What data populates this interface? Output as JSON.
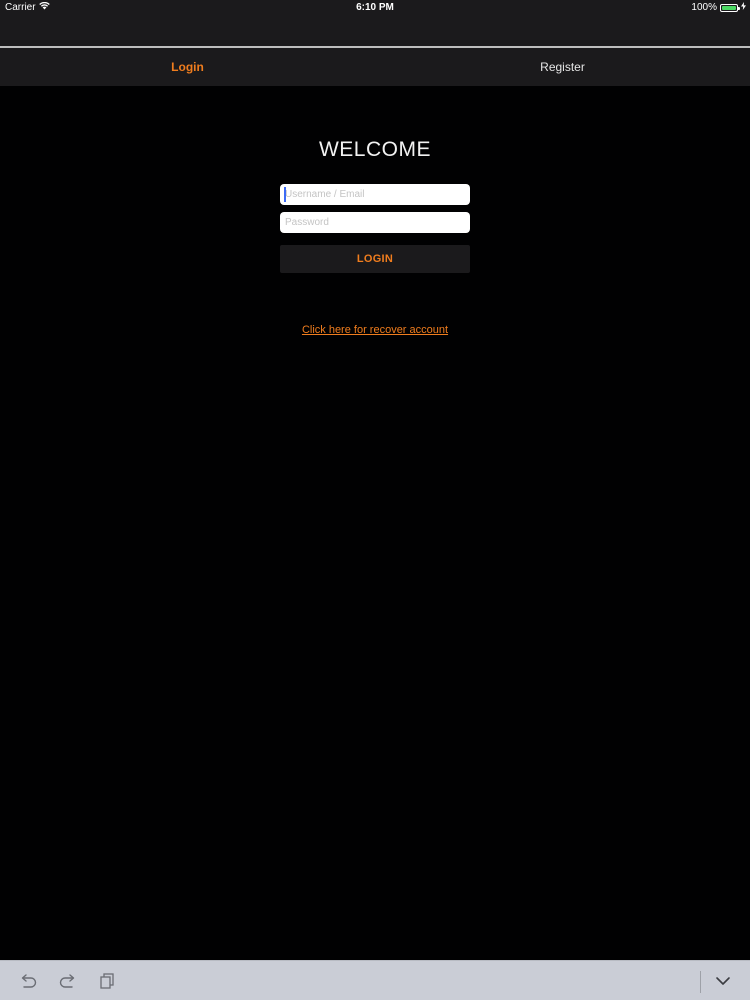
{
  "status_bar": {
    "carrier": "Carrier",
    "time": "6:10 PM",
    "battery": "100%",
    "battery_level": 1.0,
    "wifi_icon": "wifi-icon",
    "battery_icon": "battery-icon",
    "charging_icon": "charging-bolt-icon"
  },
  "tabs": [
    {
      "label": "Login",
      "active": true
    },
    {
      "label": "Register",
      "active": false
    }
  ],
  "welcome": "WELCOME",
  "form": {
    "username_placeholder": "Username / Email",
    "username_value": "",
    "password_placeholder": "Password",
    "password_value": "",
    "login_label": "LOGIN"
  },
  "recover_link": "Click here for recover account",
  "keyboard_bar": {
    "undo_icon": "undo-icon",
    "redo_icon": "redo-icon",
    "paste_icon": "paste-icon",
    "dismiss_icon": "chevron-down-icon"
  },
  "colors": {
    "accent": "#f07d1e",
    "bar_background": "#1b1a1c",
    "content_background": "#010102",
    "keyboard_bar": "#cacdd6",
    "cursor": "#3d6bf5",
    "battery": "#4cd964"
  }
}
